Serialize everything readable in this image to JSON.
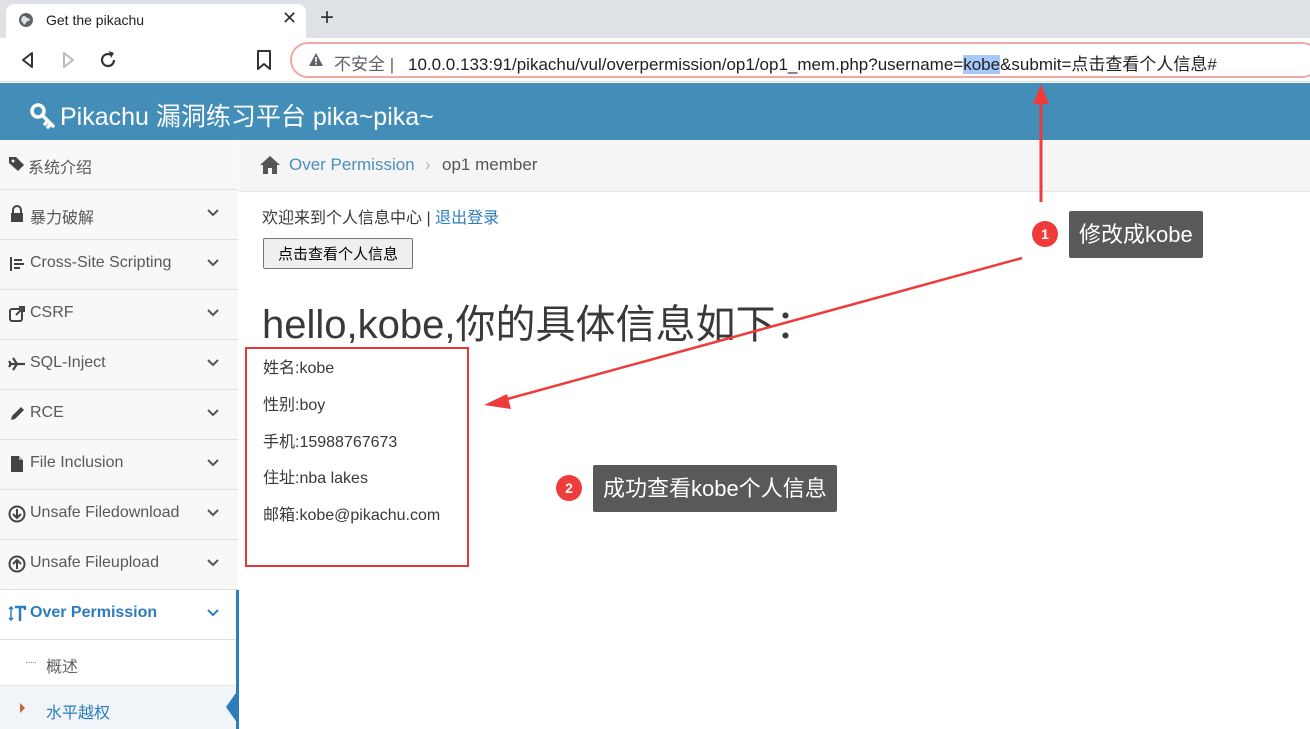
{
  "browser": {
    "tab_title": "Get the pikachu",
    "tab_close": "✕",
    "new_tab": "+",
    "insecure_label": "不安全",
    "url_prefix": "10.0.0.133:91/pikachu/vul/overpermission/op1/op1_mem.php?username=",
    "url_highlight": "kobe",
    "url_suffix": "&submit=点击查看个人信息#"
  },
  "site": {
    "brand": "Pikachu 漏洞练习平台 pika~pika~"
  },
  "sidebar": {
    "items": [
      {
        "icon": "tag-icon",
        "label": "系统介绍"
      },
      {
        "icon": "lock-icon",
        "label": "暴力破解"
      },
      {
        "icon": "list-icon",
        "label": "Cross-Site Scripting"
      },
      {
        "icon": "share-icon",
        "label": "CSRF"
      },
      {
        "icon": "plane-icon",
        "label": "SQL-Inject"
      },
      {
        "icon": "pencil-icon",
        "label": "RCE"
      },
      {
        "icon": "file-icon",
        "label": "File Inclusion"
      },
      {
        "icon": "download-icon",
        "label": "Unsafe Filedownload"
      },
      {
        "icon": "upload-icon",
        "label": "Unsafe Fileupload"
      },
      {
        "icon": "text-height-icon",
        "label": "Over Permission"
      }
    ],
    "sub_items": [
      {
        "label": "概述"
      },
      {
        "label": "水平越权"
      }
    ]
  },
  "breadcrumb": {
    "link": "Over Permission",
    "separator": "›",
    "current": "op1 member"
  },
  "main": {
    "welcome_text": "欢迎来到个人信息中心",
    "welcome_sep": " | ",
    "logout": "退出登录",
    "view_button": "点击查看个人信息",
    "hello": "hello,kobe,你的具体信息如下：",
    "info": [
      "姓名:kobe",
      "性别:boy",
      "手机:15988767673",
      "住址:nba lakes",
      "邮箱:kobe@pikachu.com"
    ]
  },
  "annotations": {
    "badge1": "1",
    "callout1": "修改成kobe",
    "badge2": "2",
    "callout2": "成功查看kobe个人信息",
    "accent_color": "#ee3b3b"
  }
}
